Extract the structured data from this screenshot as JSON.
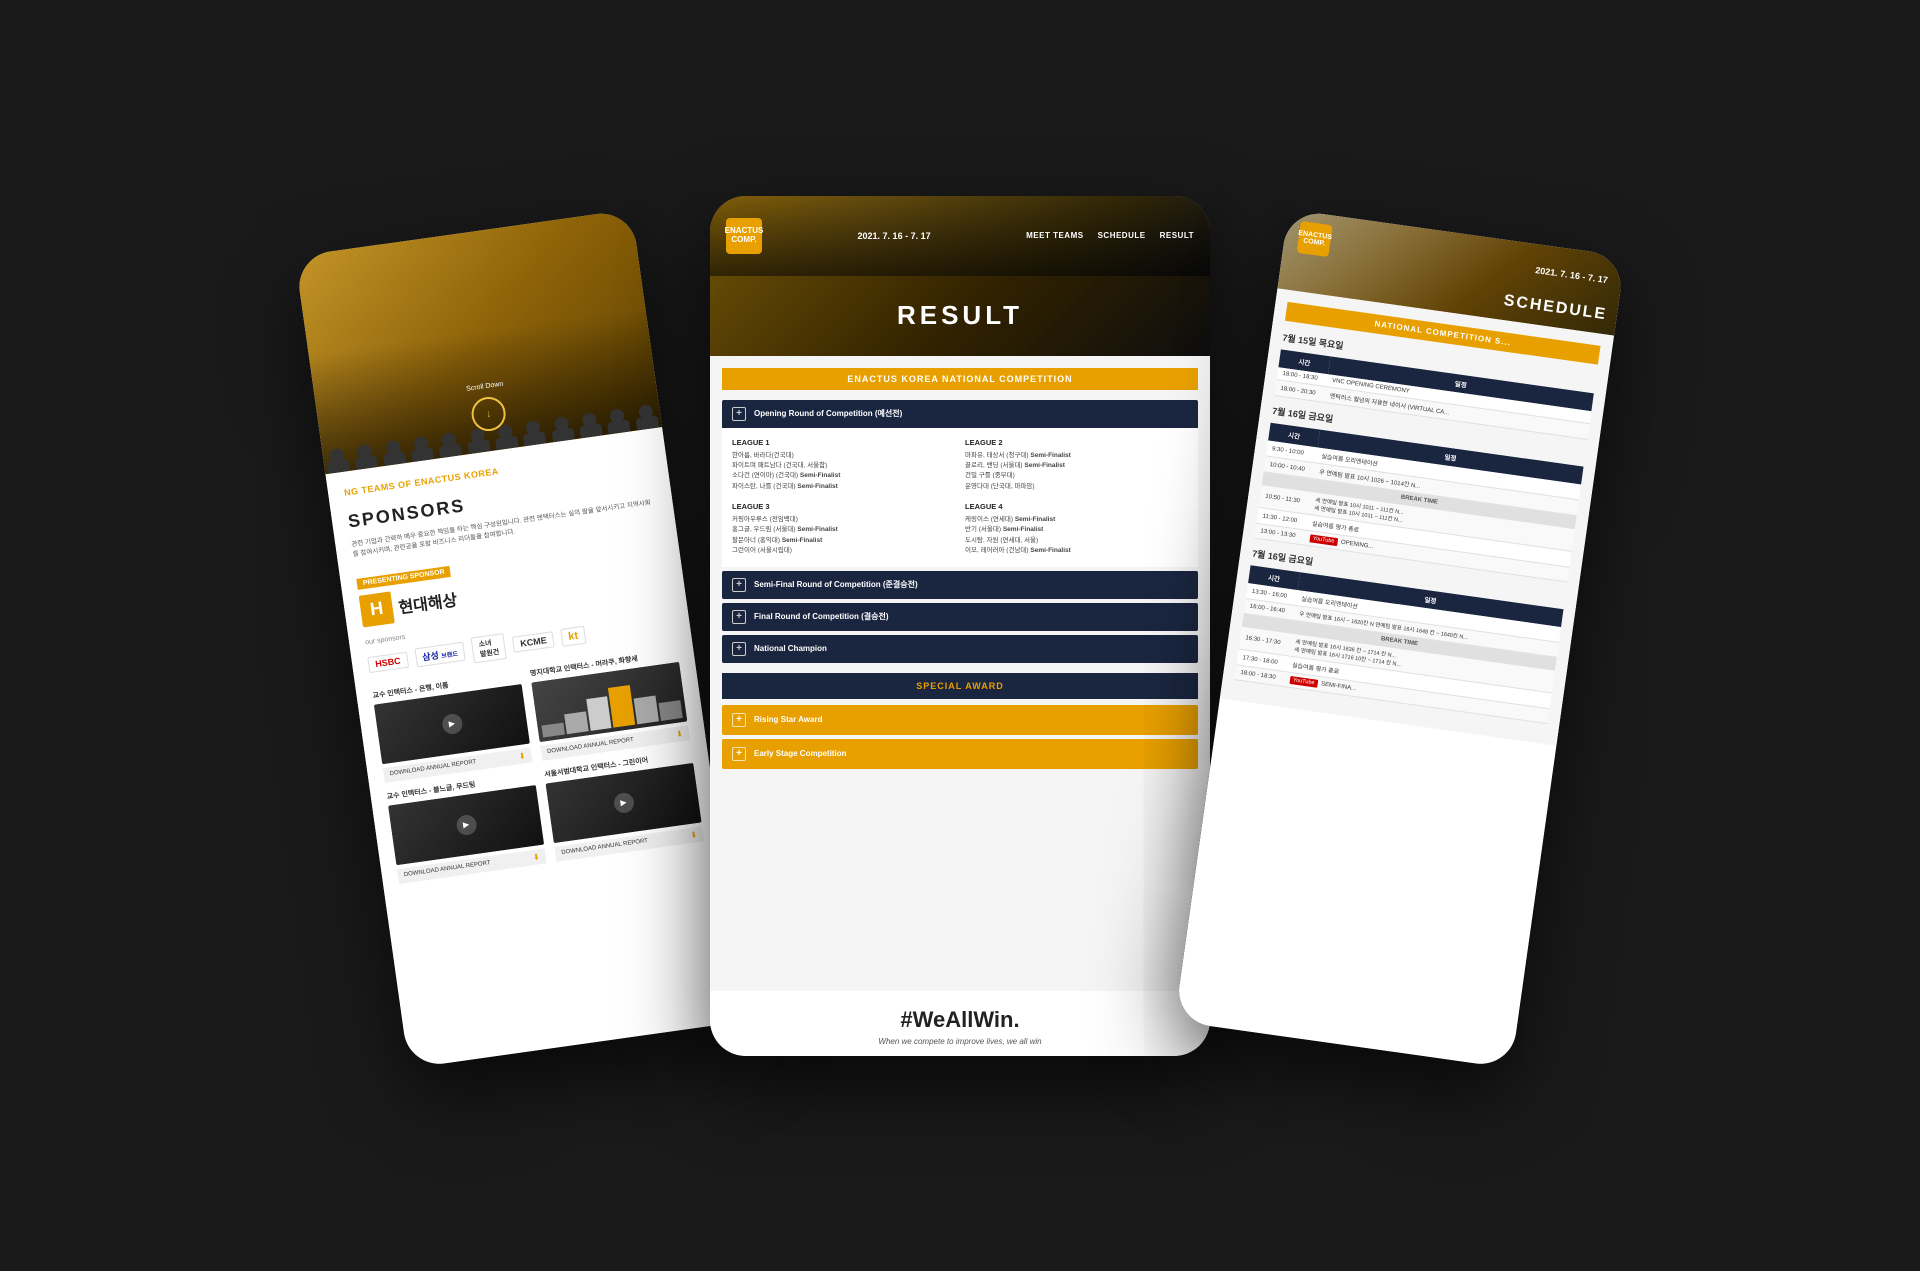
{
  "left_tablet": {
    "hero": {
      "scroll_down": "Scroll Down"
    },
    "teams_heading": "NG TEAMS OF ENACTUS KOREA",
    "sponsors": {
      "title": "SPONSORS",
      "description": "관련 기업과 간략하 매우 중요한 책임을 하는 핵심 구성원입니다. 관련 엔택터스는 실의 팔을 앞서시키고 지역사회를 참여시키며, 관련공을 포함 비즈니스 리더들을 참여합니다.",
      "presenting_label": "PRESENTING SPONSOR",
      "hyundai_h": "H",
      "hyundai_name": "현대해상",
      "our_sponsors": "our sponsors",
      "sponsor_logos": [
        "HSBC",
        "삼성 브랜드",
        "소녀 발원건",
        "KCME",
        "kt"
      ]
    },
    "news": [
      {
        "title": "교수 인택터스 - 은행, 이름",
        "download_label": "DOWNLOAD ANNUAL REPORT"
      },
      {
        "title": "명지대학교 인택터스 - 머라쿠, 화향세",
        "download_label": "DOWNLOAD ANNUAL REPORT"
      },
      {
        "title": "교수 인택터스 - 블느글, 무드팅",
        "download_label": "DOWNLOAD ANNUAL REPORT"
      },
      {
        "title": "서울서범대학교 인택터스 - 그린이어",
        "download_label": "DOWNLOAD ANNUAL REPORT"
      }
    ]
  },
  "center_tablet": {
    "header": {
      "date": "2021. 7. 16 - 7. 17",
      "logo_text": "ENACTUS\nCOMPETITION",
      "nav": [
        "MEET TEAMS",
        "SCHEDULE",
        "RESULT"
      ]
    },
    "hero_title": "RESULT",
    "competition_title": "ENACTUS KOREA NATIONAL COMPETITION",
    "opening_round": {
      "label": "Opening Round of Competition (예선전)",
      "league1": {
        "title": "LEAGUE 1",
        "teams": [
          "한아름, 바라다(건국대)",
          "파이트며 패트남다 (건국대, 서울함)",
          "소다건 (연이마) (건국대) Semi-Finalist",
          "파이스탄, 나를 (건국대) Semi-Finalist"
        ]
      },
      "league2": {
        "title": "LEAGUE 2",
        "teams": [
          "마파유, 태상서 (청구대) Semi-Finalist",
          "끌로리, 밴딩 (서울대) Semi-Finalist",
          "건밀 구를 (중부대)",
          "운영다대 (단국대, 마파암)"
        ]
      },
      "league3": {
        "title": "LEAGUE 3",
        "teams": [
          "커핑아우루스 (전임백대)",
          "홍그글, 우드림 (서울대) Semi-Finalist",
          "팔문아너 (홍익대) Semi-Finalist",
          "그런이어 (서울시립대)"
        ]
      },
      "league4": {
        "title": "LEAGUE 4",
        "teams": [
          "케링이스 (연세대) Semi-Finalist",
          "반기 (서울대) Semi-Finalist",
          "도시탐, 자원 (연세대, 서울)",
          "이모, 레어러아 (건남대) Semi-Finalist"
        ]
      }
    },
    "semi_final": {
      "label": "Semi-Final Round of Competition (준결승전)"
    },
    "final": {
      "label": "Final Round of Competition (결승전)"
    },
    "national_champion": {
      "label": "National Champion"
    },
    "special_award_title": "SPECIAL AWARD",
    "rising_star": "Rising Star Award",
    "early_stage": "Early Stage Competition",
    "footer": {
      "hashtag": "#WeAllWin.",
      "sub": "When we compete to improve lives, we all win"
    }
  },
  "right_tablet": {
    "header": {
      "date": "2021. 7. 16 - 7. 17",
      "logo_text": "ENACTUS\nCOMPETITION",
      "hero_title": "SCHEDULE"
    },
    "schedule_title": "NATIONAL COMPETITION S...",
    "day1": {
      "title": "7월 15일 목요일",
      "col_time": "시간",
      "col_content": "일정",
      "rows": [
        {
          "time": "18:00 - 18:30",
          "content": "VNC OPENING CEREMONY"
        },
        {
          "time": "18:00 - 20:30",
          "content": "엔탁러스 월넘의 저용한 네이서 (VIRTUAL CA..."
        }
      ]
    },
    "day2": {
      "title": "7월 16일 금요일",
      "rows": [
        {
          "time": "9:30 - 10:00",
          "content": "실습여름 오리엔테이션"
        },
        {
          "time": "10:00 - 10:40",
          "content": "우 연예팀 발표 10시 1026 ~ 1014칸 N..."
        },
        {
          "time": "",
          "content": "BREAK TIME",
          "break": true
        },
        {
          "time": "10:50 - 11:30",
          "content": "세 연예팀 발표 10시 1011 ~ 111칸 N... 세 연예팀 발표 10시 1011 ~ 111칸 N..."
        },
        {
          "time": "11:30 - 12:00",
          "content": "실습여름 평가 종료"
        },
        {
          "time": "13:00 - 13:30",
          "content": "YouTube OPENING..."
        }
      ]
    },
    "day3": {
      "title": "7월 16일 금요일",
      "rows": [
        {
          "time": "13:30 - 16:00",
          "content": "실습여름 오리엔테이션"
        },
        {
          "time": "16:00 - 16:40",
          "content": "우 연예팀 발표 16시 ~ 1620칸 N 연예팀 발표 16시 1648 칸 ~ 1640칸 N..."
        },
        {
          "time": "",
          "content": "BREAK TIME",
          "break": true
        },
        {
          "time": "16:30 - 17:30",
          "content": "세 연예팀 발표 16시 1636 칸 ~ 1714 칸 N... 세 연예팀 발표 16시 1716 10칸 ~ 1714 칸 N..."
        },
        {
          "time": "17:30 - 18:00",
          "content": "실습여름 평가 종료"
        },
        {
          "time": "18:00 - 18:30",
          "content": "YouTube SEMI-FINA..."
        }
      ]
    }
  }
}
